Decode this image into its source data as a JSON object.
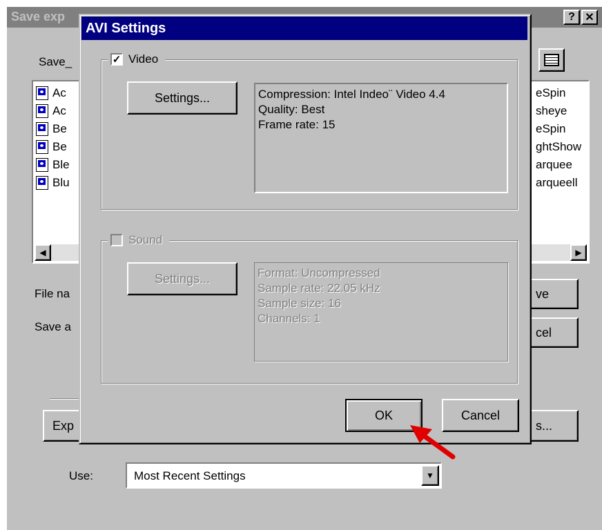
{
  "bg_dialog": {
    "title": "Save exp",
    "help_button": "?",
    "close_button": "✕",
    "save_in_label": "Save_",
    "files_left": [
      "Ac",
      "Ac",
      "Be",
      "Be",
      "Ble",
      "Blu"
    ],
    "files_right": [
      "eSpin",
      "sheye",
      "eSpin",
      "ghtShow",
      "arquee",
      "arqueell"
    ],
    "file_name_label": "File na",
    "save_as_label": "Save a",
    "save_button": "ve",
    "cancel_button": "cel",
    "export_label": "Exp",
    "settings_button": "s...",
    "use_label": "Use:",
    "use_value": "Most Recent Settings"
  },
  "avi_dialog": {
    "title": "AVI Settings",
    "video": {
      "label": "Video",
      "checked": true,
      "settings_button": "Settings...",
      "info": [
        "Compression: Intel Indeo¨ Video 4.4",
        "Quality: Best",
        "Frame rate: 15"
      ]
    },
    "sound": {
      "label": "Sound",
      "checked": false,
      "enabled": false,
      "settings_button": "Settings...",
      "info": [
        "Format: Uncompressed",
        "Sample rate: 22.05 kHz",
        "Sample size: 16",
        "Channels: 1"
      ]
    },
    "ok_button": "OK",
    "cancel_button": "Cancel"
  },
  "colors": {
    "face": "#c0c0c0",
    "title_active": "#000080",
    "title_inactive": "#808080",
    "arrow": "#e00000"
  }
}
